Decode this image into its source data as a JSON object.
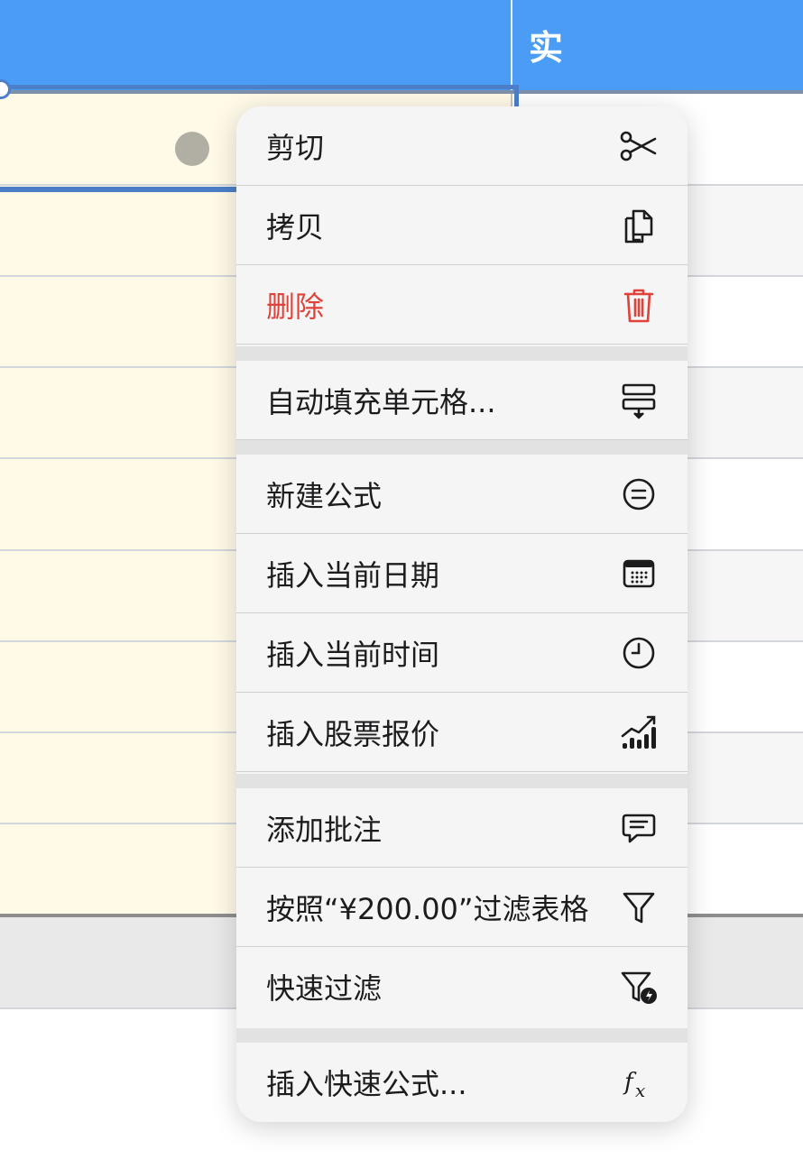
{
  "header": {
    "column_label": "实"
  },
  "menu": {
    "items": [
      {
        "label": "剪切",
        "icon": "scissors-icon"
      },
      {
        "label": "拷贝",
        "icon": "copy-icon"
      },
      {
        "label": "删除",
        "icon": "trash-icon",
        "color": "#e0423a"
      },
      {
        "label": "自动填充单元格...",
        "icon": "autofill-icon"
      },
      {
        "label": "新建公式",
        "icon": "equals-circle-icon"
      },
      {
        "label": "插入当前日期",
        "icon": "calendar-icon"
      },
      {
        "label": "插入当前时间",
        "icon": "clock-icon"
      },
      {
        "label": "插入股票报价",
        "icon": "stock-chart-icon"
      },
      {
        "label": "添加批注",
        "icon": "comment-icon"
      },
      {
        "label": "按照“¥200.00”过滤表格",
        "icon": "filter-icon"
      },
      {
        "label": "快速过滤",
        "icon": "quick-filter-icon"
      },
      {
        "label": "插入快速公式...",
        "icon": "fx-icon"
      }
    ]
  },
  "colors": {
    "header": "#4a9cf5",
    "selected_column": "#fff9e8",
    "selection": "#4c7fc8",
    "danger": "#e0423a"
  }
}
